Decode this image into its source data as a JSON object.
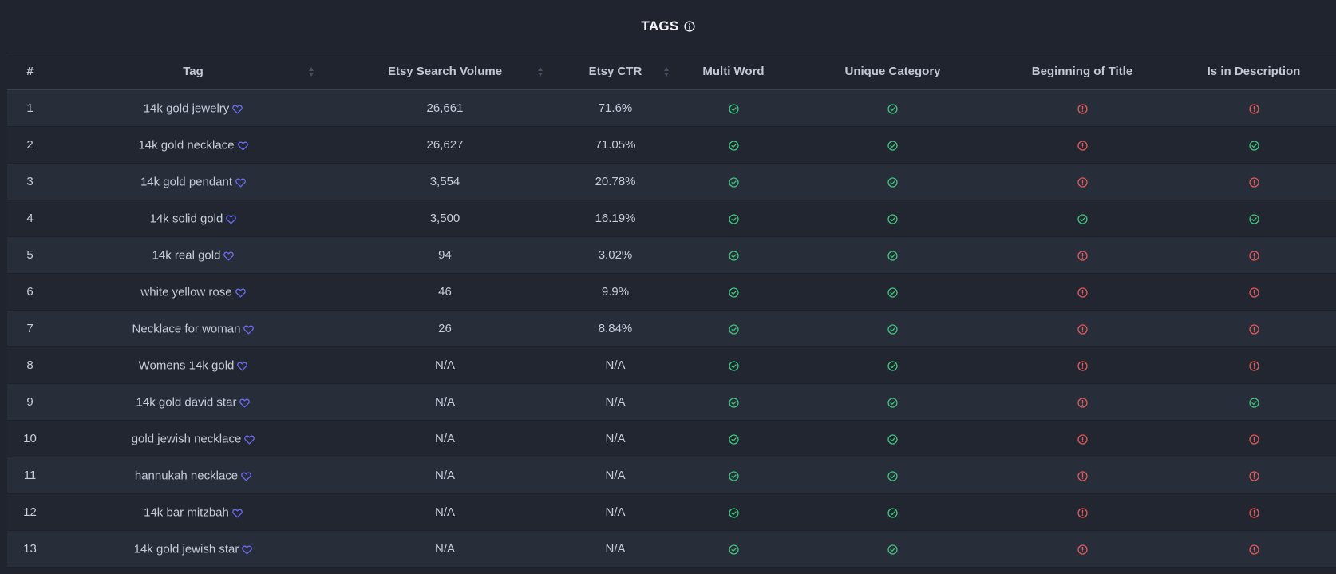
{
  "title": "TAGS",
  "colors": {
    "background": "#20242f",
    "row_odd": "#282d3a",
    "row_even": "#222631",
    "check": "#3ec47a",
    "warning": "#e05a5a",
    "heart": "#6a6cf5"
  },
  "icons": {
    "title_info": "info-icon",
    "favorite": "heart-icon",
    "yes": "check-circle-icon",
    "no": "alert-circle-icon",
    "sort": "sort-icon"
  },
  "columns": [
    {
      "label": "#",
      "sortable": false
    },
    {
      "label": "Tag",
      "sortable": true
    },
    {
      "label": "Etsy Search Volume",
      "sortable": true
    },
    {
      "label": "Etsy CTR",
      "sortable": true
    },
    {
      "label": "Multi Word",
      "sortable": false
    },
    {
      "label": "Unique Category",
      "sortable": false
    },
    {
      "label": "Beginning of Title",
      "sortable": false
    },
    {
      "label": "Is in Description",
      "sortable": false
    }
  ],
  "rows": [
    {
      "num": "1",
      "tag": "14k gold jewelry",
      "volume": "26,661",
      "ctr": "71.6%",
      "multi_word": true,
      "unique_category": true,
      "beginning_of_title": false,
      "in_description": false
    },
    {
      "num": "2",
      "tag": "14k gold necklace",
      "volume": "26,627",
      "ctr": "71.05%",
      "multi_word": true,
      "unique_category": true,
      "beginning_of_title": false,
      "in_description": true
    },
    {
      "num": "3",
      "tag": "14k gold pendant",
      "volume": "3,554",
      "ctr": "20.78%",
      "multi_word": true,
      "unique_category": true,
      "beginning_of_title": false,
      "in_description": false
    },
    {
      "num": "4",
      "tag": "14k solid gold",
      "volume": "3,500",
      "ctr": "16.19%",
      "multi_word": true,
      "unique_category": true,
      "beginning_of_title": true,
      "in_description": true
    },
    {
      "num": "5",
      "tag": "14k real gold",
      "volume": "94",
      "ctr": "3.02%",
      "multi_word": true,
      "unique_category": true,
      "beginning_of_title": false,
      "in_description": false
    },
    {
      "num": "6",
      "tag": "white yellow rose",
      "volume": "46",
      "ctr": "9.9%",
      "multi_word": true,
      "unique_category": true,
      "beginning_of_title": false,
      "in_description": false
    },
    {
      "num": "7",
      "tag": "Necklace for woman",
      "volume": "26",
      "ctr": "8.84%",
      "multi_word": true,
      "unique_category": true,
      "beginning_of_title": false,
      "in_description": false
    },
    {
      "num": "8",
      "tag": "Womens 14k gold",
      "volume": "N/A",
      "ctr": "N/A",
      "multi_word": true,
      "unique_category": true,
      "beginning_of_title": false,
      "in_description": false
    },
    {
      "num": "9",
      "tag": "14k gold david star",
      "volume": "N/A",
      "ctr": "N/A",
      "multi_word": true,
      "unique_category": true,
      "beginning_of_title": false,
      "in_description": true
    },
    {
      "num": "10",
      "tag": "gold jewish necklace",
      "volume": "N/A",
      "ctr": "N/A",
      "multi_word": true,
      "unique_category": true,
      "beginning_of_title": false,
      "in_description": false
    },
    {
      "num": "11",
      "tag": "hannukah necklace",
      "volume": "N/A",
      "ctr": "N/A",
      "multi_word": true,
      "unique_category": true,
      "beginning_of_title": false,
      "in_description": false
    },
    {
      "num": "12",
      "tag": "14k bar mitzbah",
      "volume": "N/A",
      "ctr": "N/A",
      "multi_word": true,
      "unique_category": true,
      "beginning_of_title": false,
      "in_description": false
    },
    {
      "num": "13",
      "tag": "14k gold jewish star",
      "volume": "N/A",
      "ctr": "N/A",
      "multi_word": true,
      "unique_category": true,
      "beginning_of_title": false,
      "in_description": false
    }
  ]
}
